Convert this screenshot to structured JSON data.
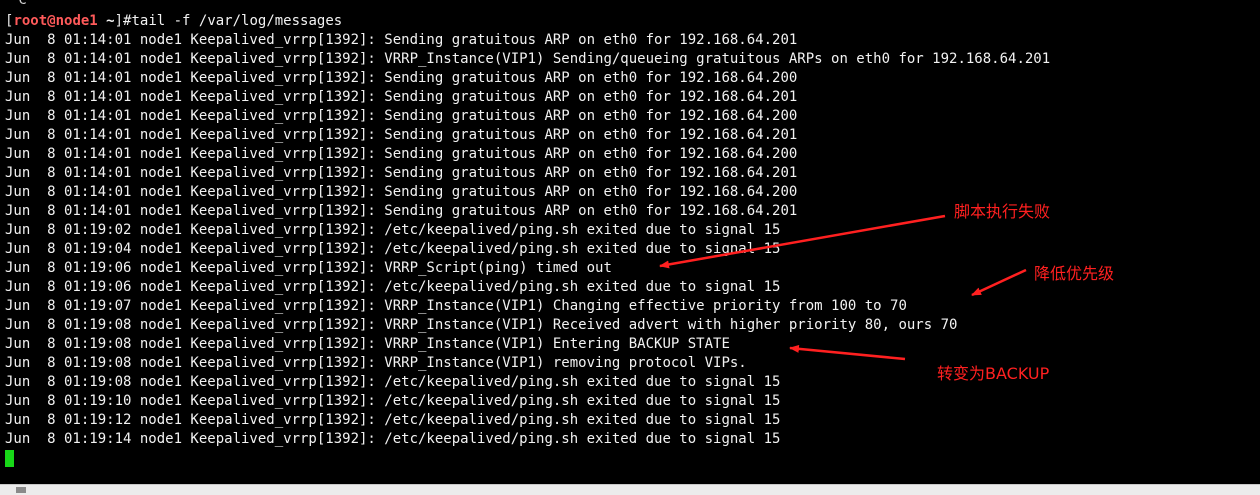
{
  "terminal": {
    "ctrl_c": "^C",
    "prompt": {
      "open": "[",
      "user_host": "root@node1",
      "dir": " ~",
      "close": "]",
      "command": "#tail -f /var/log/messages"
    },
    "lines": [
      "Jun  8 01:14:01 node1 Keepalived_vrrp[1392]: Sending gratuitous ARP on eth0 for 192.168.64.201",
      "Jun  8 01:14:01 node1 Keepalived_vrrp[1392]: VRRP_Instance(VIP1) Sending/queueing gratuitous ARPs on eth0 for 192.168.64.201",
      "Jun  8 01:14:01 node1 Keepalived_vrrp[1392]: Sending gratuitous ARP on eth0 for 192.168.64.200",
      "Jun  8 01:14:01 node1 Keepalived_vrrp[1392]: Sending gratuitous ARP on eth0 for 192.168.64.201",
      "Jun  8 01:14:01 node1 Keepalived_vrrp[1392]: Sending gratuitous ARP on eth0 for 192.168.64.200",
      "Jun  8 01:14:01 node1 Keepalived_vrrp[1392]: Sending gratuitous ARP on eth0 for 192.168.64.201",
      "Jun  8 01:14:01 node1 Keepalived_vrrp[1392]: Sending gratuitous ARP on eth0 for 192.168.64.200",
      "Jun  8 01:14:01 node1 Keepalived_vrrp[1392]: Sending gratuitous ARP on eth0 for 192.168.64.201",
      "Jun  8 01:14:01 node1 Keepalived_vrrp[1392]: Sending gratuitous ARP on eth0 for 192.168.64.200",
      "Jun  8 01:14:01 node1 Keepalived_vrrp[1392]: Sending gratuitous ARP on eth0 for 192.168.64.201",
      "Jun  8 01:19:02 node1 Keepalived_vrrp[1392]: /etc/keepalived/ping.sh exited due to signal 15",
      "Jun  8 01:19:04 node1 Keepalived_vrrp[1392]: /etc/keepalived/ping.sh exited due to signal 15",
      "Jun  8 01:19:06 node1 Keepalived_vrrp[1392]: VRRP_Script(ping) timed out",
      "Jun  8 01:19:06 node1 Keepalived_vrrp[1392]: /etc/keepalived/ping.sh exited due to signal 15",
      "Jun  8 01:19:07 node1 Keepalived_vrrp[1392]: VRRP_Instance(VIP1) Changing effective priority from 100 to 70",
      "Jun  8 01:19:08 node1 Keepalived_vrrp[1392]: VRRP_Instance(VIP1) Received advert with higher priority 80, ours 70",
      "Jun  8 01:19:08 node1 Keepalived_vrrp[1392]: VRRP_Instance(VIP1) Entering BACKUP STATE",
      "Jun  8 01:19:08 node1 Keepalived_vrrp[1392]: VRRP_Instance(VIP1) removing protocol VIPs.",
      "Jun  8 01:19:08 node1 Keepalived_vrrp[1392]: /etc/keepalived/ping.sh exited due to signal 15",
      "Jun  8 01:19:10 node1 Keepalived_vrrp[1392]: /etc/keepalived/ping.sh exited due to signal 15",
      "Jun  8 01:19:12 node1 Keepalived_vrrp[1392]: /etc/keepalived/ping.sh exited due to signal 15",
      "Jun  8 01:19:14 node1 Keepalived_vrrp[1392]: /etc/keepalived/ping.sh exited due to signal 15"
    ]
  },
  "annotations": {
    "script_failed": "脚本执行失败",
    "priority_lowered": "降低优先级",
    "to_backup": "转变为BACKUP"
  },
  "colors": {
    "background": "#000000",
    "text": "#f2f2f2",
    "prompt_user": "#ff5a5a",
    "cursor": "#18d818",
    "annotation": "#ff2020"
  }
}
